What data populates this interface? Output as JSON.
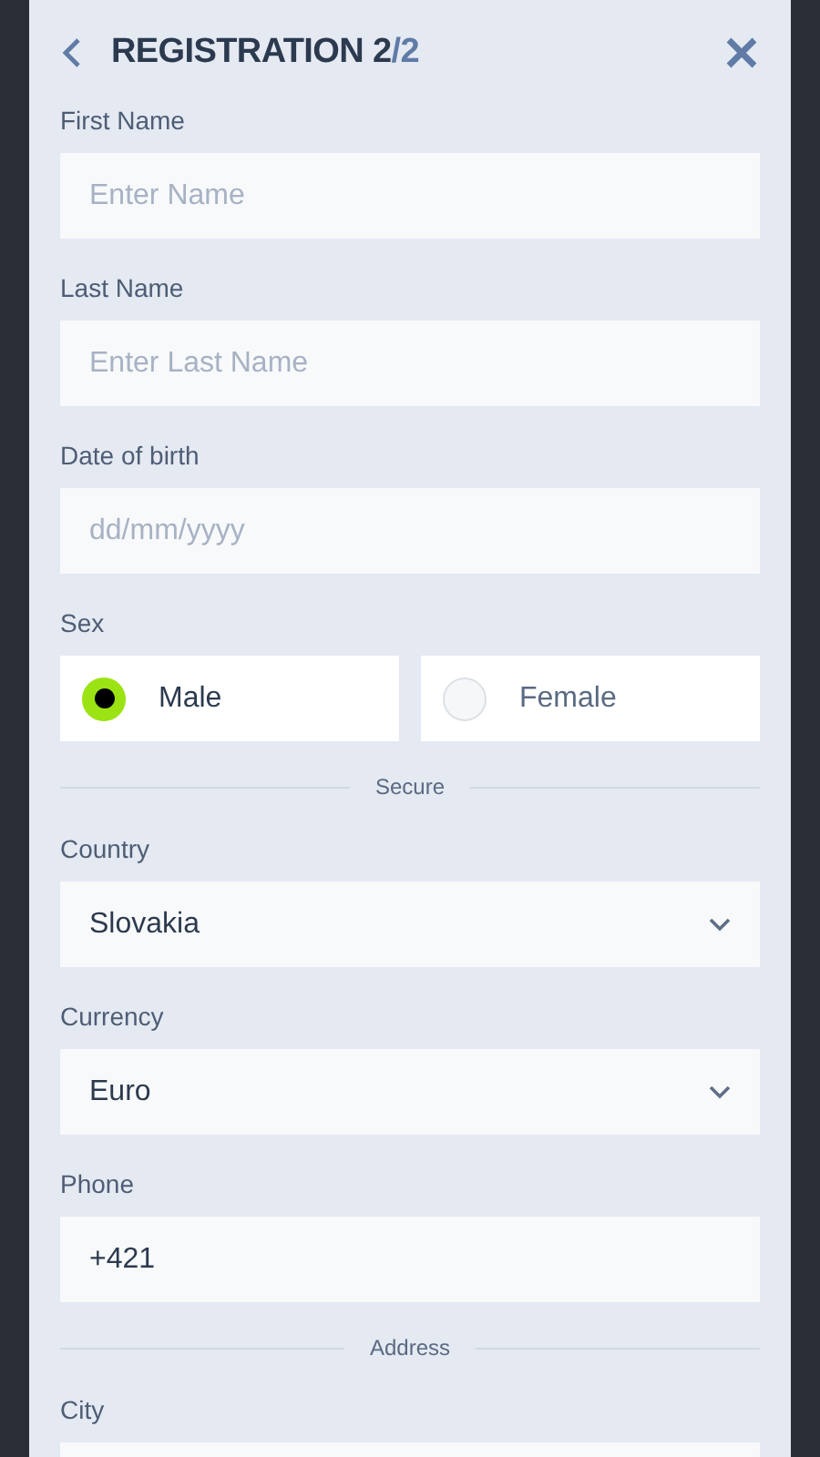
{
  "header": {
    "title": "REGISTRATION 2",
    "step_total": "/2"
  },
  "form": [
    {
      "kind": "text",
      "label": "First Name",
      "placeholder": "Enter Name"
    },
    {
      "kind": "text",
      "label": "Last Name",
      "placeholder": "Enter Last Name"
    },
    {
      "kind": "text",
      "label": "Date of birth",
      "placeholder": "dd/mm/yyyy"
    },
    {
      "kind": "radio",
      "label": "Sex",
      "options": [
        {
          "label": "Male",
          "selected": true
        },
        {
          "label": "Female",
          "selected": false
        }
      ]
    },
    {
      "kind": "divider",
      "label": "Secure"
    },
    {
      "kind": "select",
      "label": "Country",
      "value": "Slovakia"
    },
    {
      "kind": "select",
      "label": "Currency",
      "value": "Euro"
    },
    {
      "kind": "text",
      "label": "Phone",
      "value": "+421"
    },
    {
      "kind": "divider",
      "label": "Address"
    },
    {
      "kind": "text",
      "label": "City"
    }
  ]
}
